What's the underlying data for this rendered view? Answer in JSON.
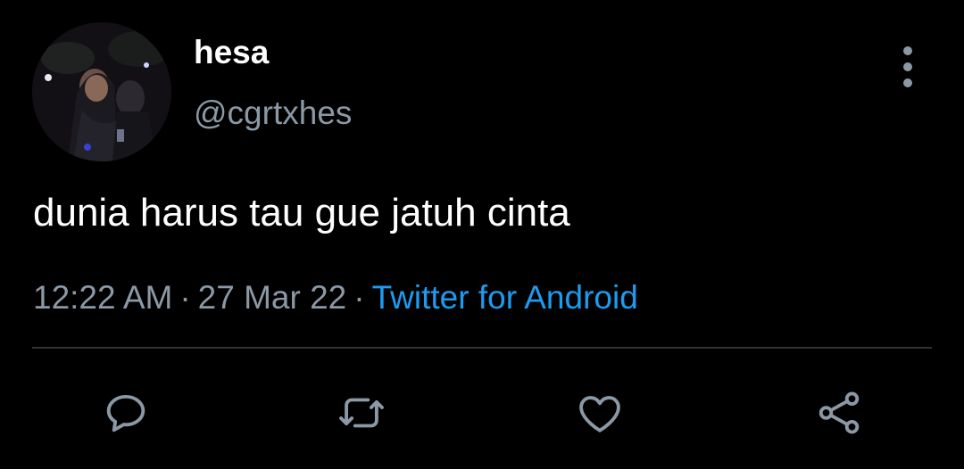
{
  "user": {
    "display_name": "hesa",
    "handle": "@cgrtxhes"
  },
  "tweet": {
    "text": "dunia harus tau gue jatuh cinta",
    "time": "12:22 AM",
    "date": "27 Mar 22",
    "separator": "·",
    "source": "Twitter for Android"
  },
  "actions": {
    "reply_icon": "speech-bubble-icon",
    "retweet_icon": "retweet-arrows-icon",
    "like_icon": "heart-icon",
    "share_icon": "share-nodes-icon"
  },
  "colors": {
    "background": "#000000",
    "text": "#ffffff",
    "secondary": "#8b98a5",
    "link": "#1d9bf0",
    "divider": "#2f3336"
  }
}
